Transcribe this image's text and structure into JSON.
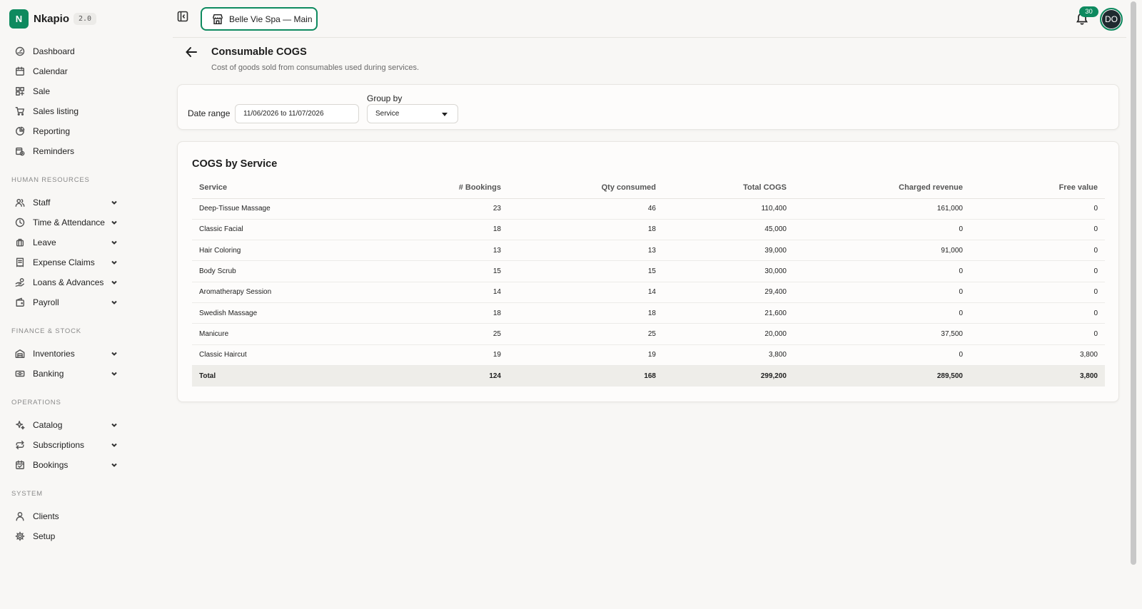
{
  "app": {
    "logo_letter": "N",
    "name": "Nkapio",
    "version": "2.0"
  },
  "sidebar": {
    "main": [
      {
        "label": "Dashboard",
        "icon": "gauge-icon"
      },
      {
        "label": "Calendar",
        "icon": "calendar-icon"
      },
      {
        "label": "Sale",
        "icon": "grid-plus-icon"
      },
      {
        "label": "Sales listing",
        "icon": "cart-icon"
      },
      {
        "label": "Reporting",
        "icon": "pie-chart-icon"
      },
      {
        "label": "Reminders",
        "icon": "calendar-clock-icon"
      }
    ],
    "sections": [
      {
        "label": "HUMAN RESOURCES",
        "items": [
          {
            "label": "Staff",
            "icon": "users-icon"
          },
          {
            "label": "Time & Attendance",
            "icon": "clock-icon"
          },
          {
            "label": "Leave",
            "icon": "luggage-icon"
          },
          {
            "label": "Expense Claims",
            "icon": "receipt-icon"
          },
          {
            "label": "Loans & Advances",
            "icon": "hand-coins-icon"
          },
          {
            "label": "Payroll",
            "icon": "wallet-icon"
          }
        ]
      },
      {
        "label": "FINANCE & STOCK",
        "items": [
          {
            "label": "Inventories",
            "icon": "warehouse-icon"
          },
          {
            "label": "Banking",
            "icon": "banknote-icon"
          }
        ]
      },
      {
        "label": "OPERATIONS",
        "items": [
          {
            "label": "Catalog",
            "icon": "sparkles-icon"
          },
          {
            "label": "Subscriptions",
            "icon": "repeat-icon"
          },
          {
            "label": "Bookings",
            "icon": "calendar-check-icon"
          }
        ]
      },
      {
        "label": "SYSTEM",
        "items": [
          {
            "label": "Clients",
            "icon": "user-icon"
          },
          {
            "label": "Setup",
            "icon": "gear-icon"
          }
        ]
      }
    ]
  },
  "topbar": {
    "location": "Belle Vie Spa — Main",
    "notifications_count": "30",
    "avatar_initials": "DO",
    "accent_color": "#0e8a5f"
  },
  "page": {
    "title": "Consumable COGS",
    "subtitle": "Cost of goods sold from consumables used during services."
  },
  "filters": {
    "date_range_label": "Date range",
    "date_range_value": "11/06/2026 to 11/07/2026",
    "group_by_label": "Group by",
    "group_by_value": "Service"
  },
  "table": {
    "title": "COGS by Service",
    "columns": [
      "Service",
      "# Bookings",
      "Qty consumed",
      "Total COGS",
      "Charged revenue",
      "Free value"
    ],
    "rows": [
      [
        "Deep-Tissue Massage",
        "23",
        "46",
        "110,400",
        "161,000",
        "0"
      ],
      [
        "Classic Facial",
        "18",
        "18",
        "45,000",
        "0",
        "0"
      ],
      [
        "Hair Coloring",
        "13",
        "13",
        "39,000",
        "91,000",
        "0"
      ],
      [
        "Body Scrub",
        "15",
        "15",
        "30,000",
        "0",
        "0"
      ],
      [
        "Aromatherapy Session",
        "14",
        "14",
        "29,400",
        "0",
        "0"
      ],
      [
        "Swedish Massage",
        "18",
        "18",
        "21,600",
        "0",
        "0"
      ],
      [
        "Manicure",
        "25",
        "25",
        "20,000",
        "37,500",
        "0"
      ],
      [
        "Classic Haircut",
        "19",
        "19",
        "3,800",
        "0",
        "3,800"
      ]
    ],
    "total": [
      "Total",
      "124",
      "168",
      "299,200",
      "289,500",
      "3,800"
    ]
  }
}
